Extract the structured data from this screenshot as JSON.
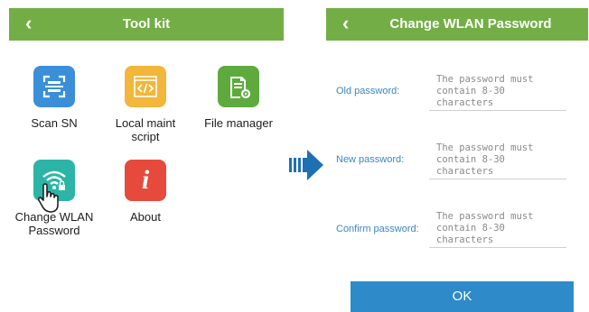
{
  "left_screen": {
    "back_glyph": "‹",
    "title": "Tool kit",
    "tiles": [
      {
        "label": "Scan SN",
        "icon": "scan-icon",
        "color": "#3b8fd8"
      },
      {
        "label": "Local maint script",
        "icon": "script-icon",
        "color": "#f2b63a"
      },
      {
        "label": "File manager",
        "icon": "file-settings-icon",
        "color": "#5faa3f"
      },
      {
        "label": "Change WLAN Password",
        "icon": "wifi-lock-icon",
        "color": "#2cb5a6"
      },
      {
        "label": "About",
        "icon": "info-icon",
        "color": "#e64a3d"
      }
    ]
  },
  "arrow_icon": "right-arrow-icon",
  "right_screen": {
    "back_glyph": "‹",
    "title": "Change WLAN Password",
    "fields": [
      {
        "label": "Old password:",
        "placeholder": "The password must contain 8-30 characters"
      },
      {
        "label": "New password:",
        "placeholder": "The password must contain 8-30 characters"
      },
      {
        "label": "Confirm password:",
        "placeholder": "The password must contain 8-30 characters"
      }
    ],
    "ok_label": "OK"
  },
  "colors": {
    "header_green": "#72ae45",
    "ok_blue": "#2e8ac8",
    "label_blue": "#3a86c4"
  }
}
